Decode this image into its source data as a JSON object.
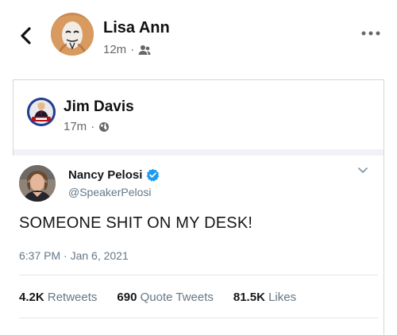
{
  "post": {
    "author": "Lisa Ann",
    "time": "12m",
    "privacy_icon": "friends-icon"
  },
  "shared_post": {
    "author": "Jim Davis",
    "time": "17m",
    "privacy_icon": "globe-icon"
  },
  "tweet": {
    "name": "Nancy Pelosi",
    "handle": "@SpeakerPelosi",
    "text": "SOMEONE SHIT ON MY DESK!",
    "timestamp": "6:37 PM · Jan 6, 2021",
    "retweets_count": "4.2K",
    "retweets_label": "Retweets",
    "quotes_count": "690",
    "quotes_label": "Quote Tweets",
    "likes_count": "81.5K",
    "likes_label": "Likes"
  },
  "colors": {
    "verified": "#1d9bf0",
    "secondary_text": "#65676b",
    "separator": "#f0f2f5"
  }
}
